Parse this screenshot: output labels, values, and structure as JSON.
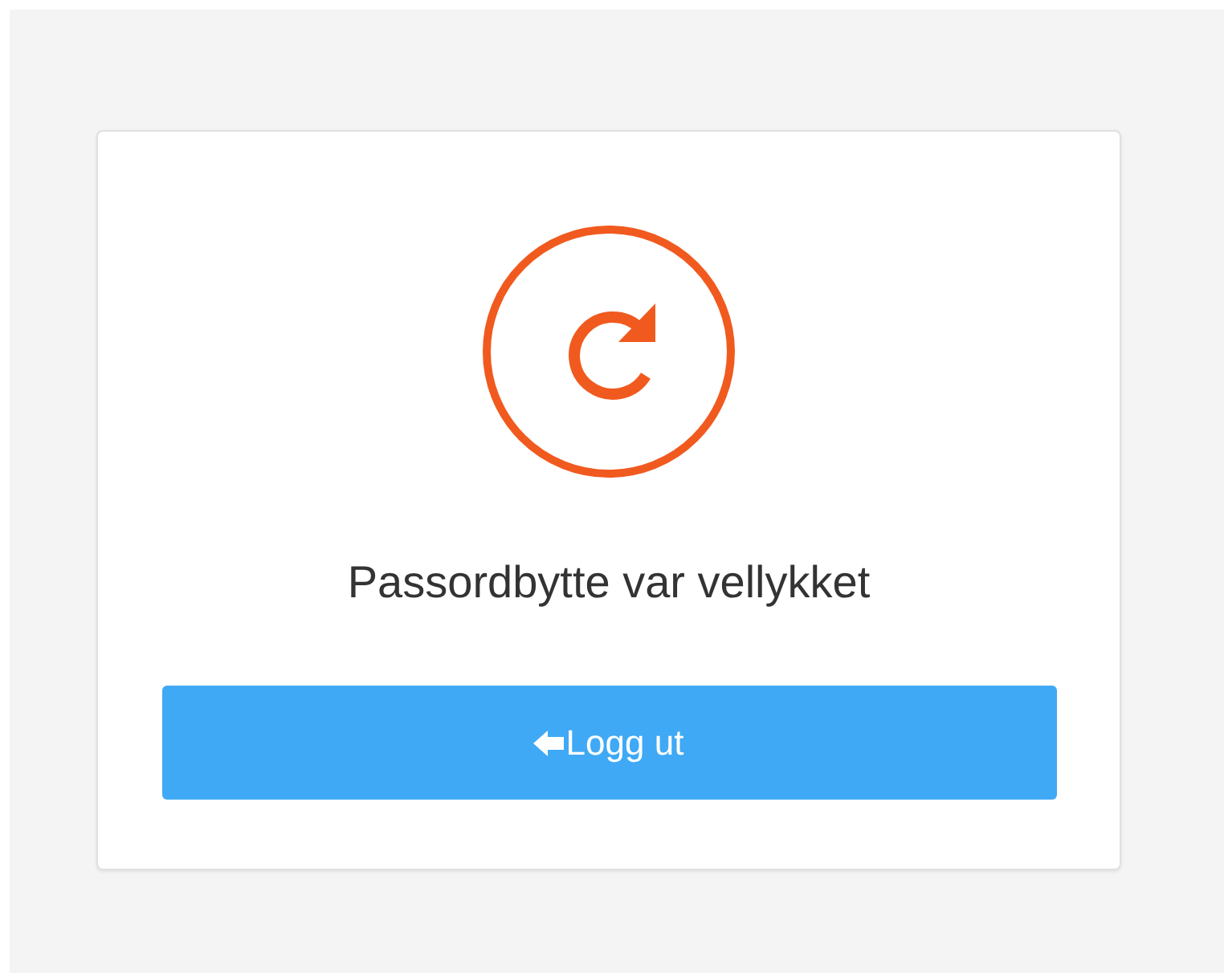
{
  "message": "Passordbytte var vellykket",
  "button": {
    "label": "Logg ut"
  }
}
